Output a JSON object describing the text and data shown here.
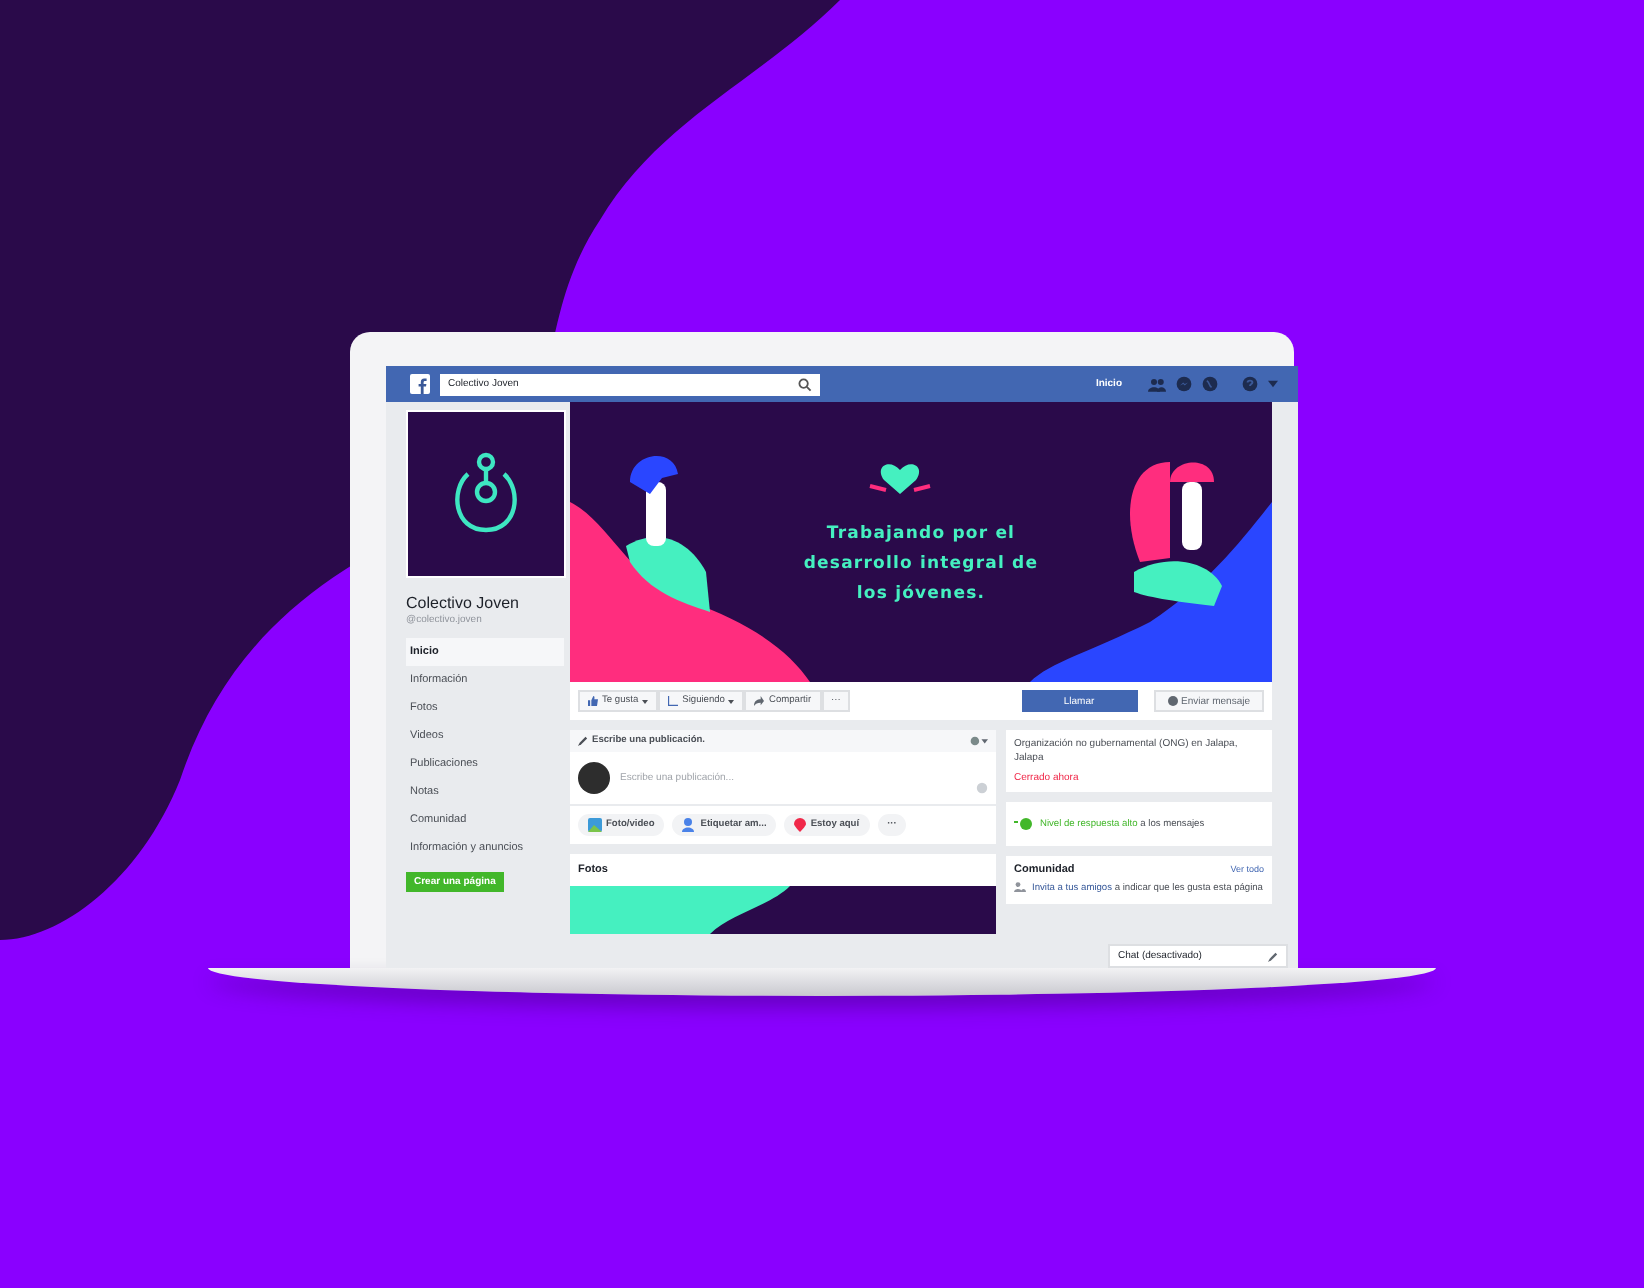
{
  "topbar": {
    "search_value": "Colectivo Joven",
    "nav_link": "Inicio"
  },
  "page": {
    "name": "Colectivo Joven",
    "handle": "@colectivo.joven",
    "create_button": "Crear una página",
    "nav": [
      {
        "label": "Inicio",
        "selected": true
      },
      {
        "label": "Información",
        "selected": false
      },
      {
        "label": "Fotos",
        "selected": false
      },
      {
        "label": "Videos",
        "selected": false
      },
      {
        "label": "Publicaciones",
        "selected": false
      },
      {
        "label": "Notas",
        "selected": false
      },
      {
        "label": "Comunidad",
        "selected": false
      },
      {
        "label": "Información y anuncios",
        "selected": false
      }
    ]
  },
  "cover": {
    "text": "Trabajando por el desarrollo integral de los jóvenes."
  },
  "actions": [
    {
      "label": "Te gusta",
      "kind": "like",
      "caret": true
    },
    {
      "label": "Siguiendo",
      "kind": "follow",
      "caret": true
    },
    {
      "label": "Compartir",
      "kind": "share",
      "caret": false
    }
  ],
  "more": "···",
  "call_button": "Llamar",
  "message_button": "Enviar mensaje",
  "composer": {
    "header": "Escribe una publicación.",
    "placeholder": "Escribe una publicación...",
    "options": [
      {
        "label": "Foto/video",
        "kind": "photo"
      },
      {
        "label": "Etiquetar am...",
        "kind": "tag"
      },
      {
        "label": "Estoy aquí",
        "kind": "place"
      }
    ],
    "more": "···"
  },
  "photos": {
    "title": "Fotos"
  },
  "about": {
    "description": "Organización no gubernamental (ONG) en Jalapa, Jalapa",
    "status": "Cerrado ahora"
  },
  "response": {
    "highlight": "Nivel de respuesta alto",
    "rest": " a los mensajes"
  },
  "community": {
    "title": "Comunidad",
    "link": "Ver todo",
    "invite_link": "Invita a tus amigos",
    "invite_rest": " a indicar que les gusta esta página"
  },
  "chat": {
    "label": "Chat (desactivado)"
  }
}
